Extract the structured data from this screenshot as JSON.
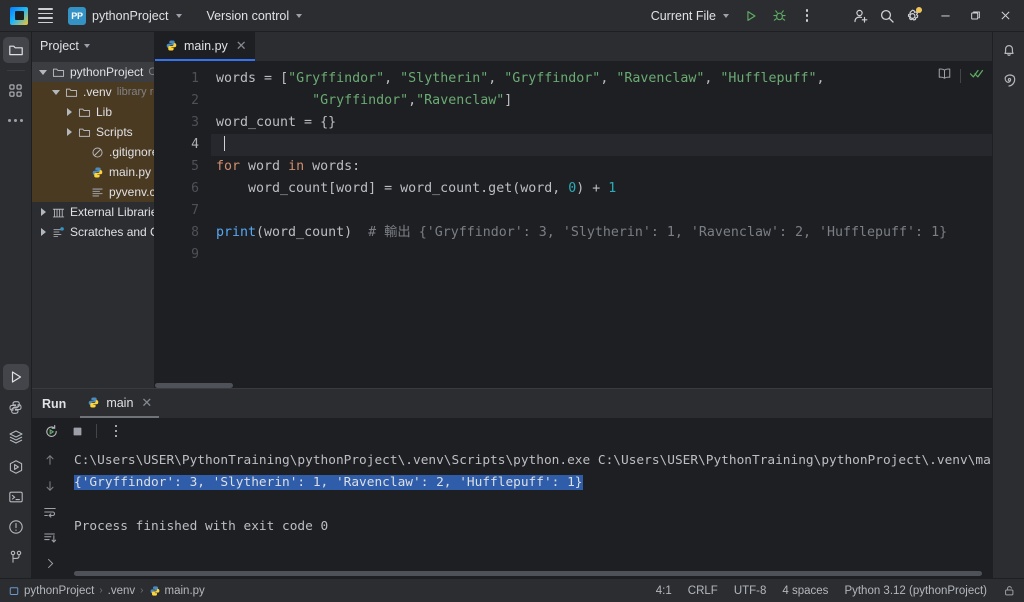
{
  "titlebar": {
    "menu_icon": "hamburger-icon",
    "project_badge": "PP",
    "project_name": "pythonProject",
    "version_control": "Version control",
    "current_file": "Current File",
    "run_icon": "run-icon",
    "debug_icon": "debug-icon",
    "more_icon": "more-actions-icon",
    "account_icon": "add-account-icon",
    "search_icon": "search-icon",
    "settings_icon": "settings-gear-icon",
    "minimize": "−",
    "maximize": "❐",
    "close": "✕"
  },
  "left_strip": {
    "items": [
      {
        "name": "project-tool-window",
        "icon": "folder-icon",
        "active": true
      },
      {
        "name": "structure-tool-window",
        "icon": "structure-icon",
        "active": false
      },
      {
        "name": "more-tool-windows",
        "icon": "ellipsis-icon",
        "active": false
      }
    ],
    "bottom_items": [
      {
        "name": "run-tool-window",
        "icon": "run-play-icon",
        "active": true
      },
      {
        "name": "python-console",
        "icon": "python-icon",
        "active": false
      },
      {
        "name": "services",
        "icon": "layers-icon",
        "active": false
      },
      {
        "name": "coverage",
        "icon": "run-coverage-icon",
        "active": false
      },
      {
        "name": "terminal",
        "icon": "terminal-icon",
        "active": false
      },
      {
        "name": "problems",
        "icon": "warning-circle-icon",
        "active": false
      },
      {
        "name": "version-control",
        "icon": "git-branch-icon",
        "active": false
      }
    ]
  },
  "right_strip": {
    "items": [
      {
        "name": "notifications",
        "icon": "bell-icon"
      },
      {
        "name": "ai-assistant",
        "icon": "spiral-icon"
      }
    ]
  },
  "project_pane": {
    "title": "Project",
    "tree": [
      {
        "label": "pythonProject",
        "note": "C:\\",
        "icon": "folder-icon",
        "arrow": "down",
        "indent": 0,
        "selected": true,
        "highlight": false
      },
      {
        "label": ".venv",
        "note": "library root",
        "icon": "folder-icon",
        "arrow": "down",
        "indent": 1,
        "selected": false,
        "highlight": true
      },
      {
        "label": "Lib",
        "note": "",
        "icon": "folder-icon",
        "arrow": "right",
        "indent": 2,
        "selected": false,
        "highlight": true
      },
      {
        "label": "Scripts",
        "note": "",
        "icon": "folder-icon",
        "arrow": "right",
        "indent": 2,
        "selected": false,
        "highlight": true
      },
      {
        "label": ".gitignore",
        "note": "",
        "icon": "gitignore-icon",
        "arrow": "none",
        "indent": 3,
        "selected": false,
        "highlight": true
      },
      {
        "label": "main.py",
        "note": "",
        "icon": "python-file-icon",
        "arrow": "none",
        "indent": 3,
        "selected": false,
        "highlight": true
      },
      {
        "label": "pyvenv.cfg",
        "note": "",
        "icon": "config-file-icon",
        "arrow": "none",
        "indent": 3,
        "selected": false,
        "highlight": true
      },
      {
        "label": "External Libraries",
        "note": "",
        "icon": "library-icon",
        "arrow": "right",
        "indent": 0,
        "selected": false,
        "highlight": false
      },
      {
        "label": "Scratches and Cor",
        "note": "",
        "icon": "scratches-icon",
        "arrow": "right",
        "indent": 0,
        "selected": false,
        "highlight": false
      }
    ]
  },
  "editor": {
    "tab": {
      "label": "main.py",
      "icon": "python-file-icon",
      "close": "✕"
    },
    "widgets": {
      "reader_mode": "reader-mode-icon",
      "inspections": "inspections-ok-icon"
    },
    "line_numbers": [
      "1",
      "2",
      "3",
      "4",
      "5",
      "6",
      "7",
      "8",
      "9"
    ],
    "current_line": 4,
    "code_lines": [
      {
        "n": 1,
        "tokens": [
          {
            "t": "words ",
            "c": "id"
          },
          {
            "t": "= ",
            "c": "id"
          },
          {
            "t": "[",
            "c": "id"
          },
          {
            "t": "\"Gryffindor\"",
            "c": "s"
          },
          {
            "t": ", ",
            "c": "id"
          },
          {
            "t": "\"Slytherin\"",
            "c": "s"
          },
          {
            "t": ", ",
            "c": "id"
          },
          {
            "t": "\"Gryffindor\"",
            "c": "s"
          },
          {
            "t": ", ",
            "c": "id"
          },
          {
            "t": "\"Ravenclaw\"",
            "c": "s"
          },
          {
            "t": ", ",
            "c": "id"
          },
          {
            "t": "\"Hufflepuff\"",
            "c": "s"
          },
          {
            "t": ",",
            "c": "id"
          }
        ]
      },
      {
        "n": 2,
        "tokens": [
          {
            "t": "            ",
            "c": "id"
          },
          {
            "t": "\"Gryffindor\"",
            "c": "s"
          },
          {
            "t": ",",
            "c": "id"
          },
          {
            "t": "\"Ravenclaw\"",
            "c": "s"
          },
          {
            "t": "]",
            "c": "id"
          }
        ]
      },
      {
        "n": 3,
        "tokens": [
          {
            "t": "word_count = {}",
            "c": "id"
          }
        ]
      },
      {
        "n": 4,
        "tokens": []
      },
      {
        "n": 5,
        "tokens": [
          {
            "t": "for",
            "c": "k"
          },
          {
            "t": " word ",
            "c": "id"
          },
          {
            "t": "in",
            "c": "k"
          },
          {
            "t": " words:",
            "c": "id"
          }
        ]
      },
      {
        "n": 6,
        "tokens": [
          {
            "t": "    word_count[word] = word_count.get(word, ",
            "c": "id"
          },
          {
            "t": "0",
            "c": "n"
          },
          {
            "t": ") + ",
            "c": "id"
          },
          {
            "t": "1",
            "c": "n"
          }
        ]
      },
      {
        "n": 7,
        "tokens": []
      },
      {
        "n": 8,
        "tokens": [
          {
            "t": "print",
            "c": "fn"
          },
          {
            "t": "(word_count)  ",
            "c": "id"
          },
          {
            "t": "# 輸出 {'Gryffindor': 3, 'Slytherin': 1, 'Ravenclaw': 2, 'Hufflepuff': 1}",
            "c": "c"
          }
        ]
      },
      {
        "n": 9,
        "tokens": []
      }
    ]
  },
  "run_panel": {
    "title": "Run",
    "tab": {
      "label": "main",
      "icon": "python-file-icon",
      "close": "✕"
    },
    "toolbar": [
      {
        "name": "rerun-button",
        "icon": "rerun-icon"
      },
      {
        "name": "stop-button",
        "icon": "stop-icon"
      },
      {
        "name": "more-run-options",
        "icon": "more-actions-icon"
      }
    ],
    "gutter": [
      {
        "name": "prev-occurrence",
        "icon": "arrow-up-icon"
      },
      {
        "name": "next-occurrence",
        "icon": "arrow-down-icon"
      },
      {
        "name": "soft-wrap",
        "icon": "soft-wrap-icon"
      },
      {
        "name": "scroll-to-end",
        "icon": "scroll-to-end-icon"
      },
      {
        "name": "expand-console",
        "icon": "chevron-right-icon"
      }
    ],
    "console": {
      "command_line": "C:\\Users\\USER\\PythonTraining\\pythonProject\\.venv\\Scripts\\python.exe C:\\Users\\USER\\PythonTraining\\pythonProject\\.venv\\main",
      "output_line": "{'Gryffindor': 3, 'Slytherin': 1, 'Ravenclaw': 2, 'Hufflepuff': 1}",
      "exit_line": "Process finished with exit code 0"
    }
  },
  "status_bar": {
    "breadcrumb": [
      {
        "label": "pythonProject",
        "icon": "module-icon"
      },
      {
        "label": ".venv",
        "icon": "none"
      },
      {
        "label": "main.py",
        "icon": "python-file-icon"
      }
    ],
    "separator": "›",
    "caret_position": "4:1",
    "line_separator": "CRLF",
    "encoding": "UTF-8",
    "indent": "4 spaces",
    "interpreter": "Python 3.12 (pythonProject)",
    "lock_icon": "lock-open-icon"
  },
  "colors": {
    "accent": "#3574f0",
    "titlebar_bg": "#2b2d30",
    "editor_bg": "#1e1f22",
    "string": "#6aab73",
    "keyword": "#cf8e6d",
    "number": "#2aacb8",
    "comment": "#7a7e85",
    "selection": "#2f5daa",
    "venv_highlight": "#4b3a22"
  }
}
